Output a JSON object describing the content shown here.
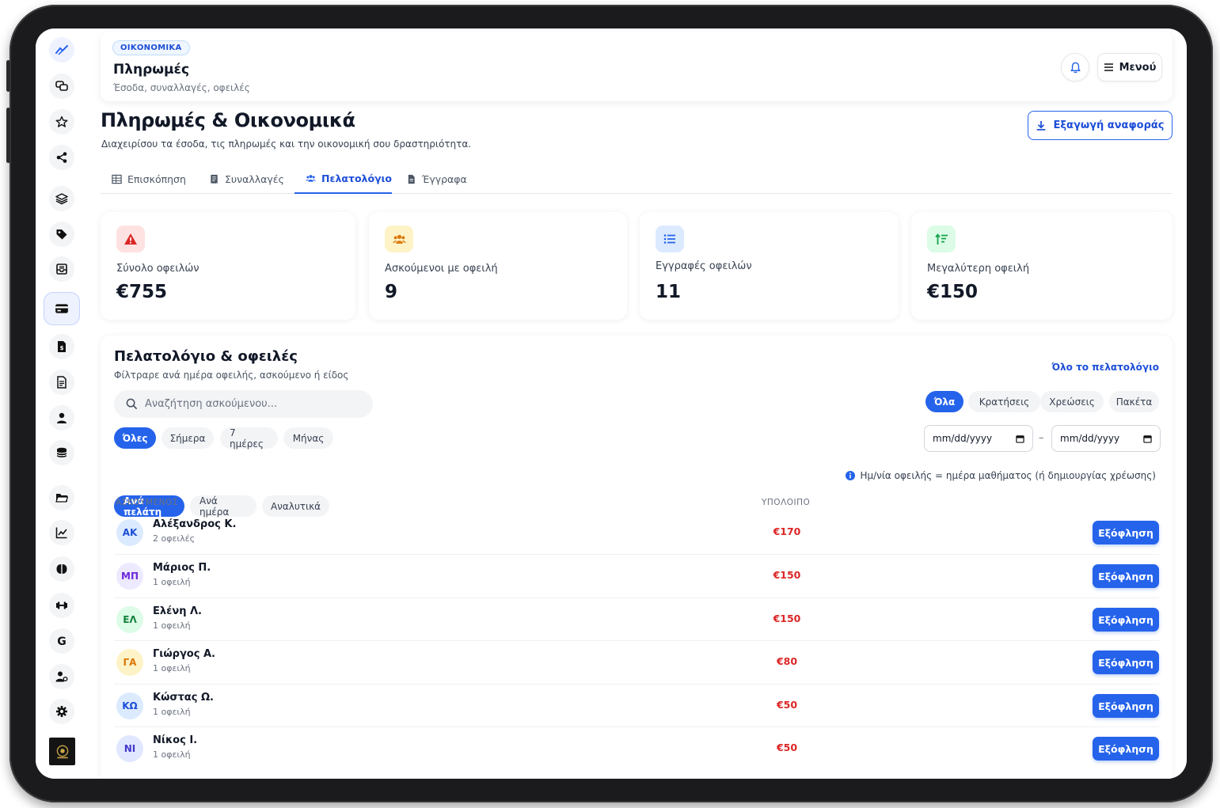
{
  "header": {
    "badge": "ΟΙΚΟΝΟΜΙΚΑ",
    "title": "Πληρωμές",
    "subtitle": "Έσοδα, συναλλαγές, οφειλές",
    "menu_label": "Μενού"
  },
  "page": {
    "title": "Πληρωμές & Οικονομικά",
    "subtitle": "Διαχειρίσου τα έσοδα, τις πληρωμές και την οικονομική σου δραστηριότητα.",
    "export_label": "Εξαγωγή αναφοράς"
  },
  "tabs": [
    {
      "label": "Επισκόπηση"
    },
    {
      "label": "Συναλλαγές"
    },
    {
      "label": "Πελατολόγιο"
    },
    {
      "label": "Έγγραφα"
    }
  ],
  "active_tab": "Πελατολόγιο",
  "stats": [
    {
      "label": "Σύνολο οφειλών",
      "value": "€755",
      "icon": "warning-icon",
      "color": "#dc2626"
    },
    {
      "label": "Ασκούμενοι με οφειλή",
      "value": "9",
      "icon": "users-icon",
      "color": "#d97706"
    },
    {
      "label": "Εγγραφές οφειλών",
      "value": "11",
      "icon": "list-icon",
      "color": "#2563eb"
    },
    {
      "label": "Μεγαλύτερη οφειλή",
      "value": "€150",
      "icon": "sort-amount-icon",
      "color": "#16a34a"
    }
  ],
  "ledger": {
    "title": "Πελατολόγιο & οφειλές",
    "subtitle": "Φίλτραρε ανά ημέρα οφειλής, ασκούμενο ή είδος",
    "all_link": "Όλο το πελατολόγιο",
    "search_placeholder": "Αναζήτηση ασκούμενου...",
    "type_filters": [
      "Όλα",
      "Κρατήσεις",
      "Χρεώσεις",
      "Πακέτα"
    ],
    "period_filters": [
      "Όλες",
      "Σήμερα",
      "7 ημέρες",
      "Μήνας"
    ],
    "view_filters": [
      "Ανά πελάτη",
      "Ανά ημέρα",
      "Αναλυτικά"
    ],
    "date_from": "mm/dd/yyyy",
    "date_to": "mm/dd/yyyy",
    "date_separator": "–",
    "info_note": "Ημ/νία οφειλής = ημέρα μαθήματος (ή δημιουργίας χρέωσης)",
    "col_client": "ΑΣΚΟΥΜΕΝΟΣ",
    "col_balance": "ΥΠΟΛΟΙΠΟ",
    "settle_label": "Εξόφληση",
    "rows": [
      {
        "initials": "ΑΚ",
        "name": "Αλέξανδρος Κ.",
        "count": "2 οφειλές",
        "balance": "€170"
      },
      {
        "initials": "ΜΠ",
        "name": "Μάριος Π.",
        "count": "1 οφειλή",
        "balance": "€150"
      },
      {
        "initials": "ΕΛ",
        "name": "Ελένη Λ.",
        "count": "1 οφειλή",
        "balance": "€150"
      },
      {
        "initials": "ΓΑ",
        "name": "Γιώργος Α.",
        "count": "1 οφειλή",
        "balance": "€80"
      },
      {
        "initials": "ΚΩ",
        "name": "Κώστας Ω.",
        "count": "1 οφειλή",
        "balance": "€50"
      },
      {
        "initials": "ΝΙ",
        "name": "Νίκος Ι.",
        "count": "1 οφειλή",
        "balance": "€50"
      }
    ]
  },
  "sidebar_icons": [
    "trend-icon",
    "chat-icon",
    "star-icon",
    "share-icon",
    "layers-icon",
    "tag-icon",
    "inbox-icon",
    "card-icon",
    "invoice-icon",
    "document-icon",
    "user-icon",
    "coins-icon",
    "folder-icon",
    "chart-icon",
    "brain-icon",
    "dumbbell-icon",
    "google-icon",
    "user-settings-icon",
    "gear-icon"
  ],
  "colors": {
    "accent": "#2563eb",
    "debt": "#dc2626"
  }
}
